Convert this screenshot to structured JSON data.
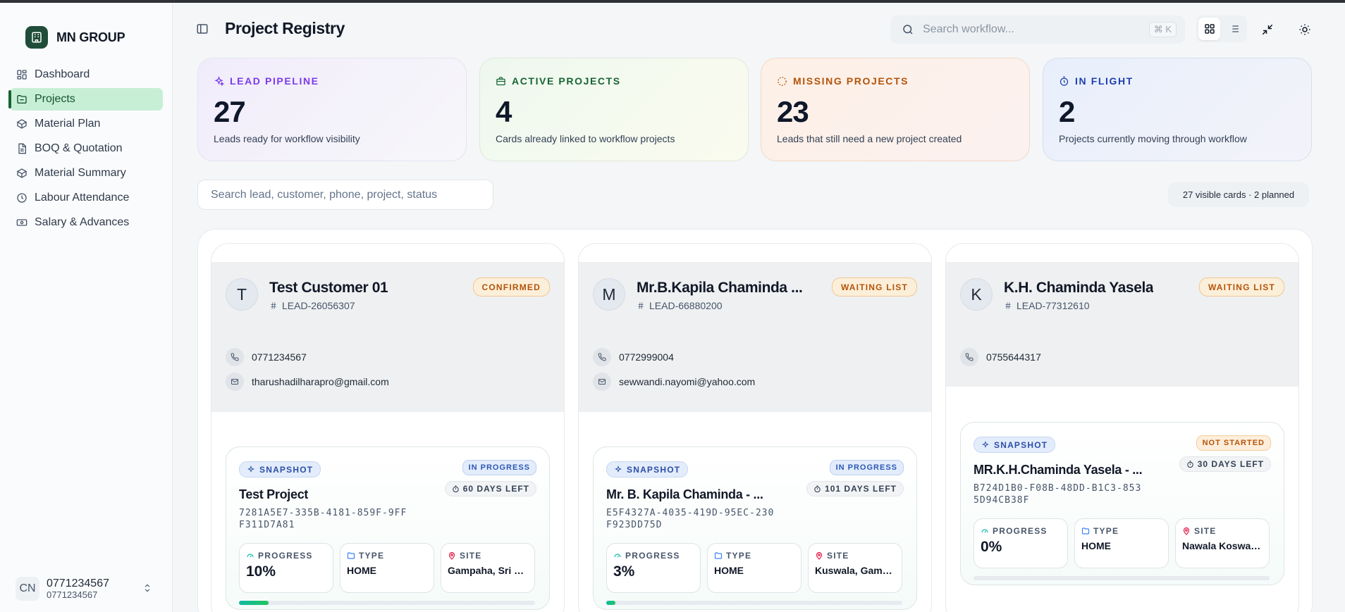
{
  "app": {
    "brand": "MN GROUP",
    "page_title": "Project Registry"
  },
  "sidebar": {
    "items": [
      {
        "label": "Dashboard",
        "icon": "dashboard-icon",
        "active": false
      },
      {
        "label": "Projects",
        "icon": "folder-icon",
        "active": true
      },
      {
        "label": "Material Plan",
        "icon": "box-icon",
        "active": false
      },
      {
        "label": "BOQ & Quotation",
        "icon": "document-icon",
        "active": false
      },
      {
        "label": "Material Summary",
        "icon": "cube-icon",
        "active": false
      },
      {
        "label": "Labour Attendance",
        "icon": "clock-icon",
        "active": false
      },
      {
        "label": "Salary & Advances",
        "icon": "money-icon",
        "active": false
      }
    ],
    "user": {
      "initials": "CN",
      "name": "0771234567",
      "sub": "0771234567"
    }
  },
  "header": {
    "search_placeholder": "Search workflow...",
    "shortcut": "⌘ K"
  },
  "stats": [
    {
      "label": "LEAD PIPELINE",
      "value": "27",
      "desc": "Leads ready for workflow visibility",
      "color": "#7c3aed"
    },
    {
      "label": "ACTIVE PROJECTS",
      "value": "4",
      "desc": "Cards already linked to workflow projects",
      "color": "#166534"
    },
    {
      "label": "MISSING PROJECTS",
      "value": "23",
      "desc": "Leads that still need a new project created",
      "color": "#b45309"
    },
    {
      "label": "IN FLIGHT",
      "value": "2",
      "desc": "Projects currently moving through workflow",
      "color": "#1e40af"
    }
  ],
  "filter": {
    "placeholder": "Search lead, customer, phone, project, status",
    "visible_summary": "27 visible cards · 2 planned"
  },
  "leads": [
    {
      "initial": "T",
      "name": "Test Customer 01",
      "lead_id": "LEAD-26056307",
      "status": "CONFIRMED",
      "phone": "0771234567",
      "email": "tharushadilharapro@gmail.com",
      "project": {
        "snapshot_label": "SNAPSHOT",
        "status": "IN PROGRESS",
        "days_left": "60 DAYS LEFT",
        "name": "Test Project",
        "uuid": "7281A5E7-335B-4181-859F-9FFF311D7A81",
        "progress_label": "PROGRESS",
        "progress": "10%",
        "progress_value": 0.1,
        "type_label": "TYPE",
        "type": "HOME",
        "site_label": "SITE",
        "site": "Gampaha, Sri La..."
      }
    },
    {
      "initial": "M",
      "name": "Mr.B.Kapila Chaminda ...",
      "lead_id": "LEAD-66880200",
      "status": "WAITING LIST",
      "phone": "0772999004",
      "email": "sewwandi.nayomi@yahoo.com",
      "project": {
        "snapshot_label": "SNAPSHOT",
        "status": "IN PROGRESS",
        "days_left": "101 DAYS LEFT",
        "name": "Mr. B. Kapila Chaminda - ...",
        "uuid": "E5F4327A-4035-419D-95EC-230F923DD75D",
        "progress_label": "PROGRESS",
        "progress": "3%",
        "progress_value": 0.03,
        "type_label": "TYPE",
        "type": "HOME",
        "site_label": "SITE",
        "site": "Kuswala, Gamp..."
      }
    },
    {
      "initial": "K",
      "name": "K.H. Chaminda Yasela",
      "lead_id": "LEAD-77312610",
      "status": "WAITING LIST",
      "phone": "0755644317",
      "email": "",
      "project": {
        "snapshot_label": "SNAPSHOT",
        "status": "NOT STARTED",
        "days_left": "30 DAYS LEFT",
        "name": "MR.K.H.Chaminda Yasela - ...",
        "uuid": "B724D1B0-F08B-48DD-B1C3-8535D94CB38F",
        "progress_label": "PROGRESS",
        "progress": "0%",
        "progress_value": 0.0,
        "type_label": "TYPE",
        "type": "HOME",
        "site_label": "SITE",
        "site": "Nawala Koswatt..."
      }
    }
  ]
}
